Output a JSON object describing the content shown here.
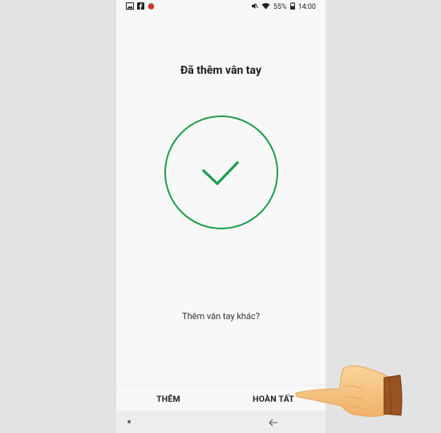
{
  "status_bar": {
    "left_icons": [
      "image-icon",
      "facebook-icon",
      "tomato-icon"
    ],
    "right_icons": [
      "mute-icon",
      "wifi-icon"
    ],
    "battery": "55%",
    "time": "14:00"
  },
  "screen": {
    "title": "Đã thêm vân tay",
    "question": "Thêm vân tay khác?",
    "accent_color": "#1e9c4c"
  },
  "buttons": {
    "add_label": "THÊM",
    "done_label": "HOÀN TẤT"
  },
  "navbar": {
    "home_icon": "dot-icon",
    "back_icon": "back-arrow-icon"
  }
}
